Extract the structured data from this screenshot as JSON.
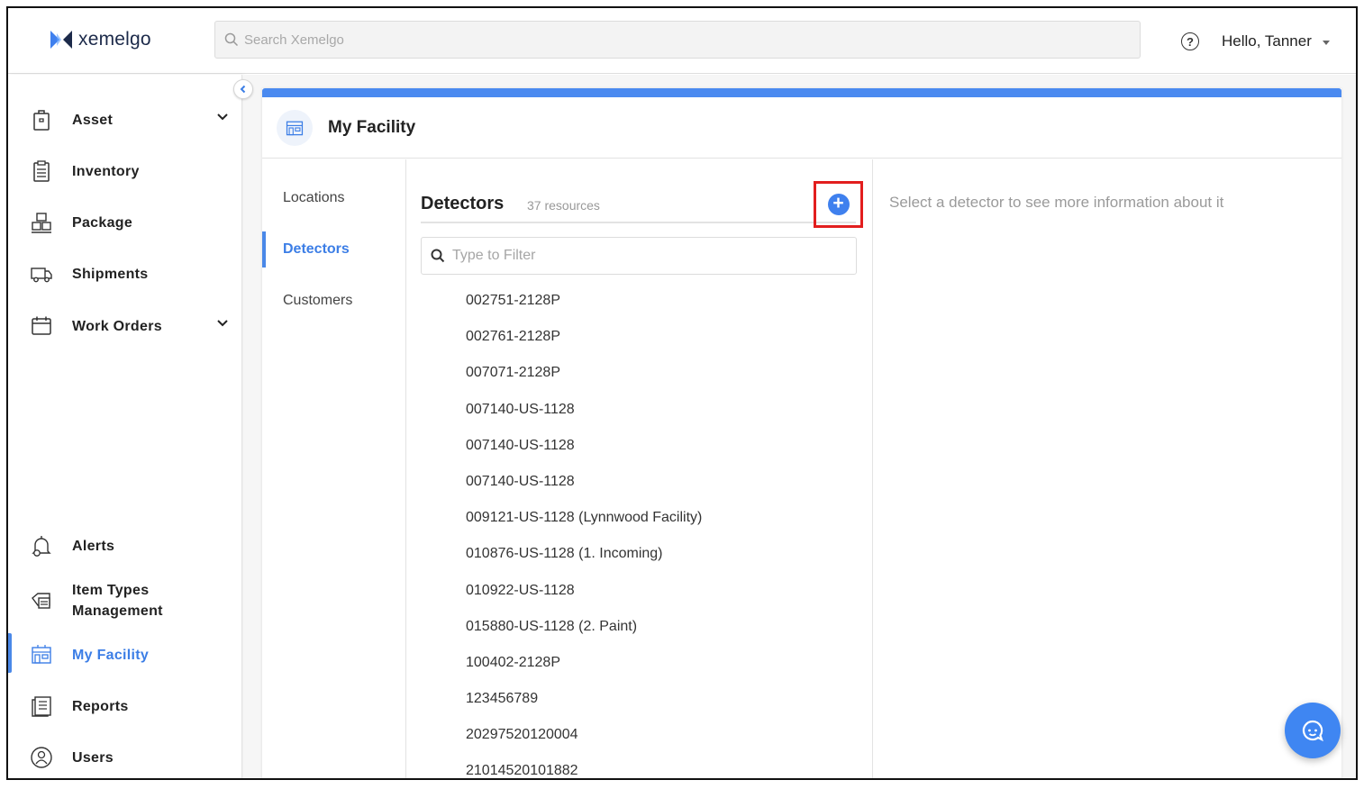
{
  "app": {
    "name": "xemelgo",
    "brand_color": "#3f80ee",
    "highlight_color": "#e21e1e"
  },
  "header": {
    "search_placeholder": "Search Xemelgo",
    "help_label": "?",
    "greeting": "Hello, Tanner"
  },
  "sidebar": {
    "items": [
      {
        "label": "Asset",
        "icon": "asset-icon",
        "expandable": true
      },
      {
        "label": "Inventory",
        "icon": "inventory-icon",
        "expandable": false
      },
      {
        "label": "Package",
        "icon": "package-icon",
        "expandable": false
      },
      {
        "label": "Shipments",
        "icon": "truck-icon",
        "expandable": false
      },
      {
        "label": "Work Orders",
        "icon": "calendar-icon",
        "expandable": true
      },
      {
        "label": "Alerts",
        "icon": "bell-icon",
        "expandable": false
      },
      {
        "label": "Item Types Management",
        "label_line1": "Item Types",
        "label_line2": "Management",
        "icon": "item-types-icon",
        "expandable": false
      },
      {
        "label": "My Facility",
        "icon": "facility-icon",
        "expandable": false,
        "active": true
      },
      {
        "label": "Reports",
        "icon": "reports-icon",
        "expandable": false
      },
      {
        "label": "Users",
        "icon": "users-icon",
        "expandable": false
      }
    ]
  },
  "page": {
    "title": "My Facility",
    "subnav": [
      {
        "label": "Locations",
        "active": false
      },
      {
        "label": "Detectors",
        "active": true
      },
      {
        "label": "Customers",
        "active": false
      }
    ],
    "list": {
      "title": "Detectors",
      "count": "37 resources",
      "filter_placeholder": "Type to Filter",
      "add_label": "+",
      "items": [
        "002751-2128P",
        "002761-2128P",
        "007071-2128P",
        "007140-US-1128",
        "007140-US-1128",
        "007140-US-1128",
        "009121-US-1128 (Lynnwood Facility)",
        "010876-US-1128 (1. Incoming)",
        "010922-US-1128",
        "015880-US-1128 (2. Paint)",
        "100402-2128P",
        "123456789",
        "20297520120004",
        "21014520101882"
      ]
    },
    "detail_message": "Select a detector to see more information about it"
  }
}
